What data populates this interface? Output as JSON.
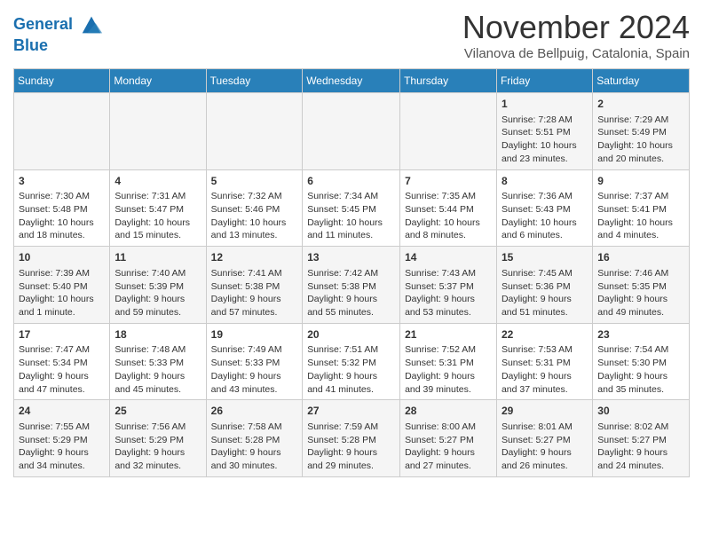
{
  "logo": {
    "line1": "General",
    "line2": "Blue"
  },
  "title": "November 2024",
  "subtitle": "Vilanova de Bellpuig, Catalonia, Spain",
  "days_of_week": [
    "Sunday",
    "Monday",
    "Tuesday",
    "Wednesday",
    "Thursday",
    "Friday",
    "Saturday"
  ],
  "weeks": [
    [
      {
        "day": "",
        "info": ""
      },
      {
        "day": "",
        "info": ""
      },
      {
        "day": "",
        "info": ""
      },
      {
        "day": "",
        "info": ""
      },
      {
        "day": "",
        "info": ""
      },
      {
        "day": "1",
        "info": "Sunrise: 7:28 AM\nSunset: 5:51 PM\nDaylight: 10 hours and 23 minutes."
      },
      {
        "day": "2",
        "info": "Sunrise: 7:29 AM\nSunset: 5:49 PM\nDaylight: 10 hours and 20 minutes."
      }
    ],
    [
      {
        "day": "3",
        "info": "Sunrise: 7:30 AM\nSunset: 5:48 PM\nDaylight: 10 hours and 18 minutes."
      },
      {
        "day": "4",
        "info": "Sunrise: 7:31 AM\nSunset: 5:47 PM\nDaylight: 10 hours and 15 minutes."
      },
      {
        "day": "5",
        "info": "Sunrise: 7:32 AM\nSunset: 5:46 PM\nDaylight: 10 hours and 13 minutes."
      },
      {
        "day": "6",
        "info": "Sunrise: 7:34 AM\nSunset: 5:45 PM\nDaylight: 10 hours and 11 minutes."
      },
      {
        "day": "7",
        "info": "Sunrise: 7:35 AM\nSunset: 5:44 PM\nDaylight: 10 hours and 8 minutes."
      },
      {
        "day": "8",
        "info": "Sunrise: 7:36 AM\nSunset: 5:43 PM\nDaylight: 10 hours and 6 minutes."
      },
      {
        "day": "9",
        "info": "Sunrise: 7:37 AM\nSunset: 5:41 PM\nDaylight: 10 hours and 4 minutes."
      }
    ],
    [
      {
        "day": "10",
        "info": "Sunrise: 7:39 AM\nSunset: 5:40 PM\nDaylight: 10 hours and 1 minute."
      },
      {
        "day": "11",
        "info": "Sunrise: 7:40 AM\nSunset: 5:39 PM\nDaylight: 9 hours and 59 minutes."
      },
      {
        "day": "12",
        "info": "Sunrise: 7:41 AM\nSunset: 5:38 PM\nDaylight: 9 hours and 57 minutes."
      },
      {
        "day": "13",
        "info": "Sunrise: 7:42 AM\nSunset: 5:38 PM\nDaylight: 9 hours and 55 minutes."
      },
      {
        "day": "14",
        "info": "Sunrise: 7:43 AM\nSunset: 5:37 PM\nDaylight: 9 hours and 53 minutes."
      },
      {
        "day": "15",
        "info": "Sunrise: 7:45 AM\nSunset: 5:36 PM\nDaylight: 9 hours and 51 minutes."
      },
      {
        "day": "16",
        "info": "Sunrise: 7:46 AM\nSunset: 5:35 PM\nDaylight: 9 hours and 49 minutes."
      }
    ],
    [
      {
        "day": "17",
        "info": "Sunrise: 7:47 AM\nSunset: 5:34 PM\nDaylight: 9 hours and 47 minutes."
      },
      {
        "day": "18",
        "info": "Sunrise: 7:48 AM\nSunset: 5:33 PM\nDaylight: 9 hours and 45 minutes."
      },
      {
        "day": "19",
        "info": "Sunrise: 7:49 AM\nSunset: 5:33 PM\nDaylight: 9 hours and 43 minutes."
      },
      {
        "day": "20",
        "info": "Sunrise: 7:51 AM\nSunset: 5:32 PM\nDaylight: 9 hours and 41 minutes."
      },
      {
        "day": "21",
        "info": "Sunrise: 7:52 AM\nSunset: 5:31 PM\nDaylight: 9 hours and 39 minutes."
      },
      {
        "day": "22",
        "info": "Sunrise: 7:53 AM\nSunset: 5:31 PM\nDaylight: 9 hours and 37 minutes."
      },
      {
        "day": "23",
        "info": "Sunrise: 7:54 AM\nSunset: 5:30 PM\nDaylight: 9 hours and 35 minutes."
      }
    ],
    [
      {
        "day": "24",
        "info": "Sunrise: 7:55 AM\nSunset: 5:29 PM\nDaylight: 9 hours and 34 minutes."
      },
      {
        "day": "25",
        "info": "Sunrise: 7:56 AM\nSunset: 5:29 PM\nDaylight: 9 hours and 32 minutes."
      },
      {
        "day": "26",
        "info": "Sunrise: 7:58 AM\nSunset: 5:28 PM\nDaylight: 9 hours and 30 minutes."
      },
      {
        "day": "27",
        "info": "Sunrise: 7:59 AM\nSunset: 5:28 PM\nDaylight: 9 hours and 29 minutes."
      },
      {
        "day": "28",
        "info": "Sunrise: 8:00 AM\nSunset: 5:27 PM\nDaylight: 9 hours and 27 minutes."
      },
      {
        "day": "29",
        "info": "Sunrise: 8:01 AM\nSunset: 5:27 PM\nDaylight: 9 hours and 26 minutes."
      },
      {
        "day": "30",
        "info": "Sunrise: 8:02 AM\nSunset: 5:27 PM\nDaylight: 9 hours and 24 minutes."
      }
    ]
  ]
}
